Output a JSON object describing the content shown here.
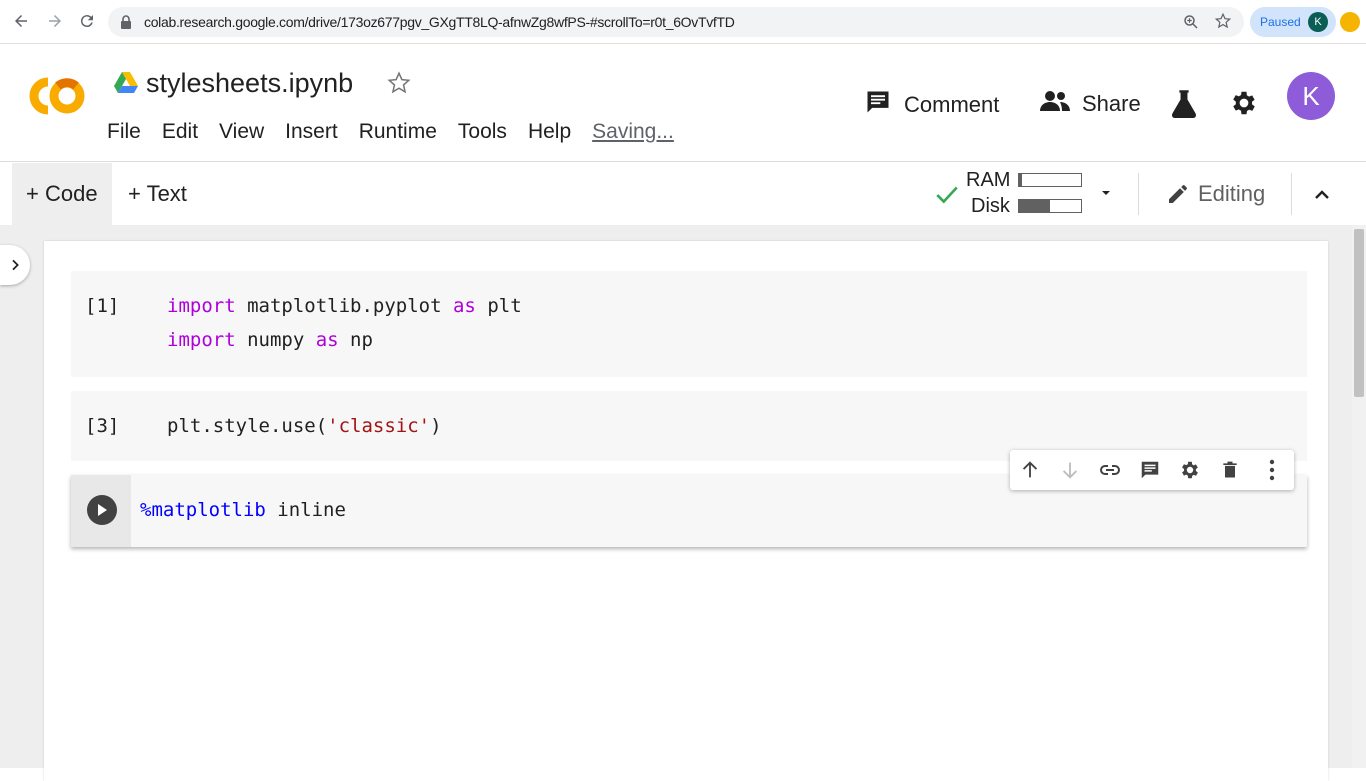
{
  "browser": {
    "url": "colab.research.google.com/drive/173oz677pgv_GXgTT8LQ-afnwZg8wfPS-#scrollTo=r0t_6OvTvfTD",
    "paused_label": "Paused",
    "profile_initial": "K"
  },
  "header": {
    "notebook_title": "stylesheets.ipynb",
    "menu": [
      "File",
      "Edit",
      "View",
      "Insert",
      "Runtime",
      "Tools",
      "Help"
    ],
    "status": "Saving...",
    "comment_label": "Comment",
    "share_label": "Share",
    "user_initial": "K"
  },
  "toolbar": {
    "code_label": "+ Code",
    "text_label": "+ Text",
    "ram_label": "RAM",
    "disk_label": "Disk",
    "ram_usage": 0.05,
    "disk_usage": 0.5,
    "editing_label": "Editing"
  },
  "cells": [
    {
      "exec_count": "[1]",
      "lines": [
        [
          {
            "t": "import",
            "c": "kw"
          },
          {
            "t": " matplotlib.pyplot ",
            "c": ""
          },
          {
            "t": "as",
            "c": "kw"
          },
          {
            "t": " plt",
            "c": ""
          }
        ],
        [
          {
            "t": "import",
            "c": "kw"
          },
          {
            "t": " numpy ",
            "c": ""
          },
          {
            "t": "as",
            "c": "kw"
          },
          {
            "t": " np",
            "c": ""
          }
        ]
      ]
    },
    {
      "exec_count": "[3]",
      "lines": [
        [
          {
            "t": "plt.style.use(",
            "c": ""
          },
          {
            "t": "'classic'",
            "c": "str"
          },
          {
            "t": ")",
            "c": ""
          }
        ]
      ]
    },
    {
      "exec_count": "",
      "lines": [
        [
          {
            "t": "%matplotlib",
            "c": "magic"
          },
          {
            "t": " inline",
            "c": ""
          }
        ]
      ]
    }
  ],
  "colors": {
    "accent": "#1a73e8",
    "avatar": "#8e5cd9",
    "keyword": "#af00db",
    "string": "#a31515",
    "magic": "#0000ff",
    "check": "#34a853"
  },
  "icons": [
    "back-icon",
    "forward-icon",
    "reload-icon",
    "lock-icon",
    "zoom-icon",
    "star-icon",
    "drive-icon",
    "comment-icon",
    "share-icon",
    "flask-icon",
    "gear-icon",
    "check-icon",
    "dropdown-icon",
    "pencil-icon",
    "chevron-up-icon",
    "chevron-right-icon",
    "run-icon",
    "arrow-up-icon",
    "arrow-down-icon",
    "link-icon",
    "comment-cell-icon",
    "cell-settings-icon",
    "delete-icon",
    "more-vert-icon"
  ]
}
